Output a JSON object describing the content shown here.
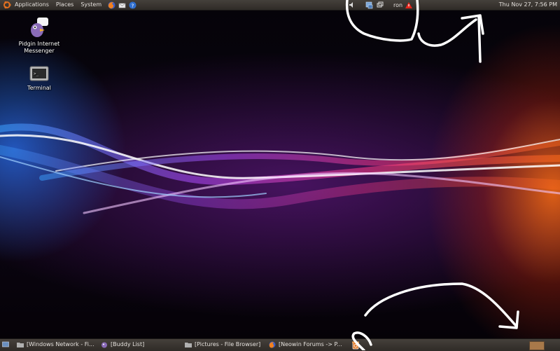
{
  "top_panel": {
    "menus": [
      "Applications",
      "Places",
      "System"
    ],
    "username": "ron",
    "clock": "Thu Nov 27,  7:56 PM"
  },
  "desktop_icons": [
    {
      "label_line1": "Pidgin Internet",
      "label_line2": "Messenger",
      "icon": "pidgin-icon"
    },
    {
      "label_line1": "Terminal",
      "label_line2": "",
      "icon": "terminal-icon"
    }
  ],
  "taskbar": {
    "items": [
      {
        "label": "[Windows Network - Fi...",
        "icon": "folder-icon"
      },
      {
        "label": "[Buddy List]",
        "icon": "pidgin-icon"
      },
      {
        "label": "[Pictures - File Browser]",
        "icon": "folder-icon"
      },
      {
        "label": "[Neowin Forums -> P...",
        "icon": "firefox-icon"
      }
    ]
  },
  "colors": {
    "panel": "#3c3833",
    "annotation": "#ffffff",
    "alert": "#e8261c",
    "workspace": "#a8794a"
  }
}
